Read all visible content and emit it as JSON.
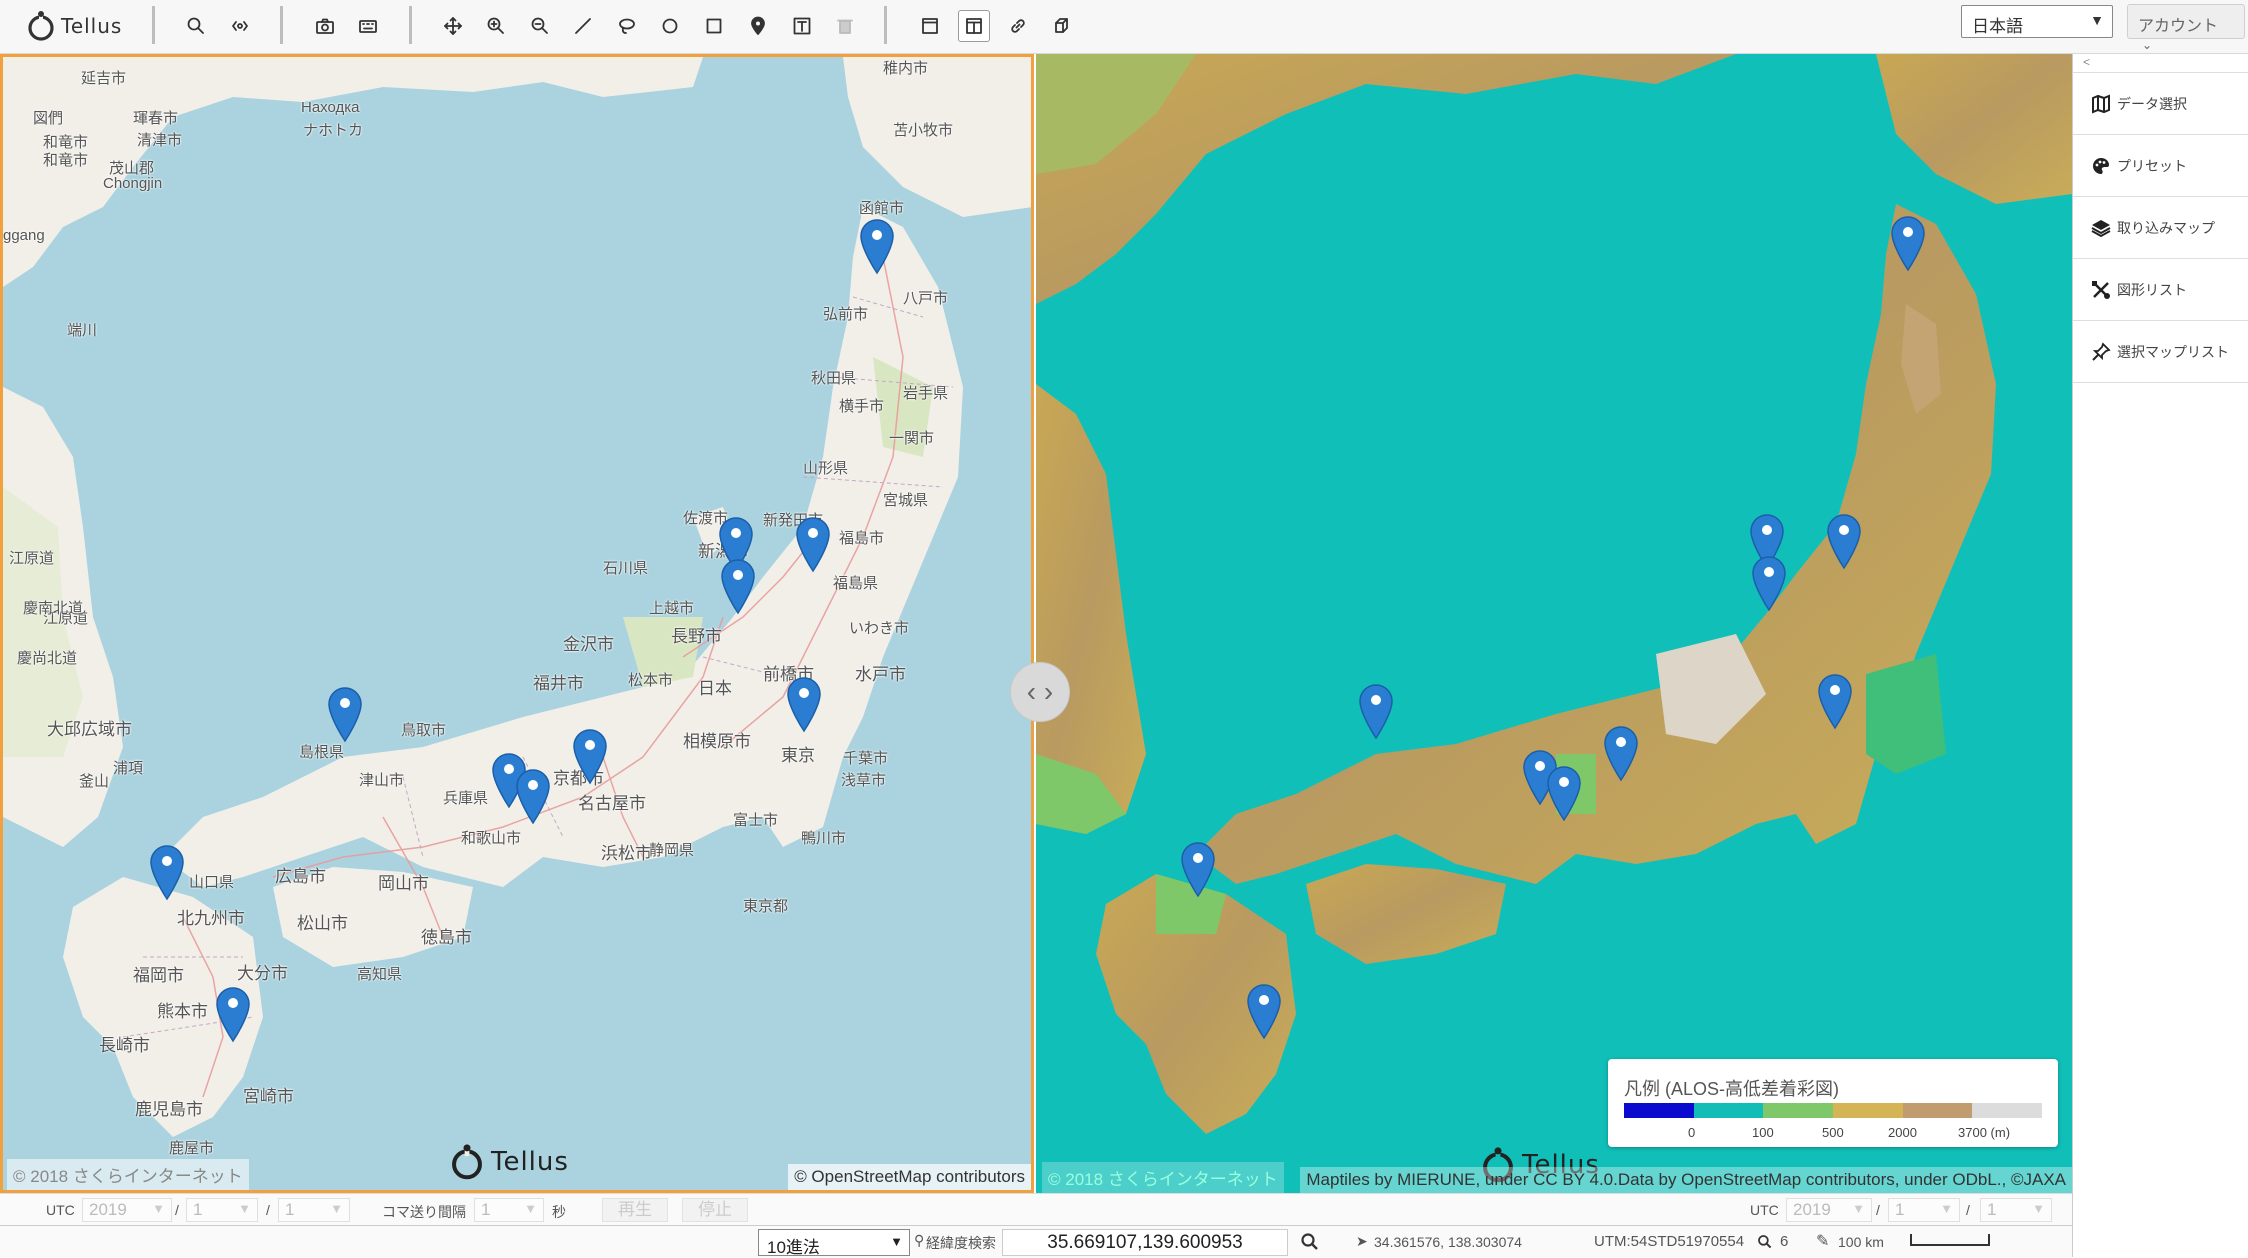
{
  "app": {
    "logo_text": "Tellus"
  },
  "toolbar": {
    "language": "日本語",
    "account": "アカウント"
  },
  "map_left": {
    "labels": [
      {
        "t": "延吉市"
      },
      {
        "t": "図們"
      },
      {
        "t": "琿春市"
      },
      {
        "t": "Находка"
      },
      {
        "t": "ナホトカ"
      },
      {
        "t": "清津市"
      },
      {
        "t": "和竜市"
      },
      {
        "t": "和竜市"
      },
      {
        "t": "茂山郡"
      },
      {
        "t": "Chongjin"
      },
      {
        "t": "ggang"
      },
      {
        "t": "端川"
      },
      {
        "t": "江原道"
      },
      {
        "t": "大邱広域市"
      },
      {
        "t": "慶尚北道"
      },
      {
        "t": "釜山"
      },
      {
        "t": "稚内市"
      },
      {
        "t": "苫小牧市"
      },
      {
        "t": "函館市"
      },
      {
        "t": "八戸市"
      },
      {
        "t": "弘前市"
      },
      {
        "t": "秋田県"
      },
      {
        "t": "岩手県"
      },
      {
        "t": "横手市"
      },
      {
        "t": "一関市"
      },
      {
        "t": "山形県"
      },
      {
        "t": "宮城県"
      },
      {
        "t": "佐渡市"
      },
      {
        "t": "新発田市"
      },
      {
        "t": "新潟市"
      },
      {
        "t": "福島市"
      },
      {
        "t": "福島県"
      },
      {
        "t": "石川県"
      },
      {
        "t": "上越市"
      },
      {
        "t": "長野市"
      },
      {
        "t": "いわき市"
      },
      {
        "t": "金沢市"
      },
      {
        "t": "福井市"
      },
      {
        "t": "松本市"
      },
      {
        "t": "日本"
      },
      {
        "t": "前橋市"
      },
      {
        "t": "水戸市"
      },
      {
        "t": "鳥取市"
      },
      {
        "t": "島根県"
      },
      {
        "t": "津山市"
      },
      {
        "t": "京都市"
      },
      {
        "t": "名古屋市"
      },
      {
        "t": "相模原市"
      },
      {
        "t": "東京"
      },
      {
        "t": "千葉市"
      },
      {
        "t": "浅草市"
      },
      {
        "t": "兵庫県"
      },
      {
        "t": "和歌山市"
      },
      {
        "t": "浜松市"
      },
      {
        "t": "静岡県"
      },
      {
        "t": "富士市"
      },
      {
        "t": "鴨川市"
      },
      {
        "t": "広島市"
      },
      {
        "t": "岡山市"
      },
      {
        "t": "山口県"
      },
      {
        "t": "北九州市"
      },
      {
        "t": "松山市"
      },
      {
        "t": "徳島市"
      },
      {
        "t": "高知県"
      },
      {
        "t": "東京都"
      },
      {
        "t": "福岡市"
      },
      {
        "t": "大分市"
      },
      {
        "t": "熊本市"
      },
      {
        "t": "長崎市"
      },
      {
        "t": "宮崎市"
      },
      {
        "t": "鹿児島市"
      },
      {
        "t": "鹿屋市"
      },
      {
        "t": "江原道"
      },
      {
        "t": "慶南北道"
      },
      {
        "t": "浦項"
      }
    ],
    "copyright": "© 2018 さくらインターネット",
    "attribution": "© OpenStreetMap contributors",
    "watermark": "Tellus"
  },
  "map_right": {
    "copyright": "© 2018 さくらインターネット",
    "attribution": "Maptiles by MIERUNE, under CC BY 4.0.Data by OpenStreetMap contributors, under ODbL., ©JAXA",
    "watermark": "Tellus",
    "legend": {
      "title": "凡例 (ALOS-高低差着彩図)",
      "colors": [
        "#0b0bd0",
        "#12bdb8",
        "#7ec86a",
        "#d4b454",
        "#c09c6e",
        "#dcdcdc"
      ],
      "ticks": [
        "0",
        "100",
        "500",
        "2000",
        "3700 (m)"
      ]
    }
  },
  "sidebar": {
    "collapse": "<",
    "items": [
      {
        "label": "データ選択",
        "icon": "map-icon"
      },
      {
        "label": "プリセット",
        "icon": "palette-icon"
      },
      {
        "label": "取り込みマップ",
        "icon": "layers-icon"
      },
      {
        "label": "図形リスト",
        "icon": "shapes-icon"
      },
      {
        "label": "選択マップリスト",
        "icon": "pushpin-icon"
      }
    ]
  },
  "timebar": {
    "utc": "UTC",
    "year": "2019",
    "month": "1",
    "day": "1",
    "sep": "/",
    "frame_label": "コマ送り間隔",
    "frame_value": "1",
    "sec": "秒",
    "play": "再生",
    "stop": "停止",
    "utc_right": "UTC",
    "year_right": "2019",
    "month_right": "1",
    "day_right": "1"
  },
  "statusbar": {
    "notation": "10進法",
    "geo_search_label": "経緯度検索",
    "coord_input": "35.669107,139.600953",
    "cursor_coord": "34.361576, 138.303074",
    "utm": "UTM:54STD51970554",
    "zoom": "6",
    "scale": "100 km"
  }
}
